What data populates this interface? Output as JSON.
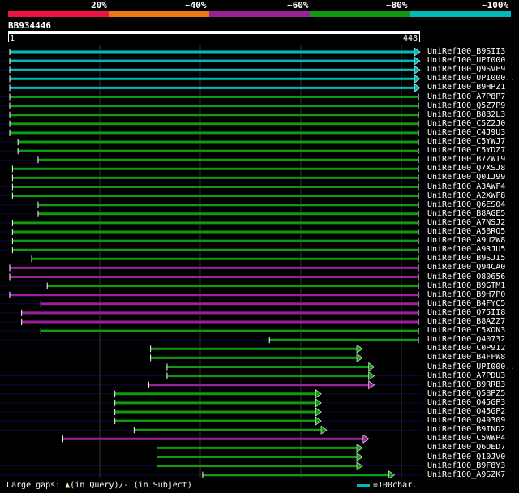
{
  "legend": {
    "labels": [
      "20%",
      "~40%",
      "~60%",
      "~80%",
      "~100%"
    ],
    "colors": [
      "#ee1144",
      "#ee7711",
      "#992299",
      "#119911",
      "#00bbbb"
    ]
  },
  "query": {
    "id": "BB934446",
    "start": "1",
    "end": "448",
    "length": 448
  },
  "footer": {
    "gaps_text": "Large gaps: ",
    "gap_query_symbol": "▲",
    "gaps_query_text": "(in Query)/",
    "gap_subject_symbol": "-",
    "gaps_subject_text": " (in Subject)",
    "scale_text": "=100char."
  },
  "hits": [
    {
      "name": "UniRef100_B9SII3",
      "color": "#00bbbb",
      "start": 1,
      "end": 448,
      "arrow": true
    },
    {
      "name": "UniRef100_UPI000..",
      "color": "#00bbbb",
      "start": 1,
      "end": 448,
      "arrow": true
    },
    {
      "name": "UniRef100_Q9SVE9",
      "color": "#00bbbb",
      "start": 1,
      "end": 448,
      "arrow": true
    },
    {
      "name": "UniRef100_UPI000..",
      "color": "#00bbbb",
      "start": 1,
      "end": 448,
      "arrow": true
    },
    {
      "name": "UniRef100_B9HPZ1",
      "color": "#00bbbb",
      "start": 1,
      "end": 448,
      "arrow": true
    },
    {
      "name": "UniRef100_A7P8P7",
      "color": "#119911",
      "start": 1,
      "end": 448,
      "arrow": false
    },
    {
      "name": "UniRef100_Q5Z7P9",
      "color": "#119911",
      "start": 1,
      "end": 448,
      "arrow": false
    },
    {
      "name": "UniRef100_B8B2L3",
      "color": "#119911",
      "start": 1,
      "end": 448,
      "arrow": false
    },
    {
      "name": "UniRef100_C5Z2J0",
      "color": "#119911",
      "start": 1,
      "end": 448,
      "arrow": false
    },
    {
      "name": "UniRef100_C4J9U3",
      "color": "#119911",
      "start": 1,
      "end": 448,
      "arrow": false
    },
    {
      "name": "UniRef100_C5YWJ7",
      "color": "#119911",
      "start": 10,
      "end": 448,
      "arrow": false
    },
    {
      "name": "UniRef100_C5YDZ7",
      "color": "#119911",
      "start": 10,
      "end": 448,
      "arrow": false
    },
    {
      "name": "UniRef100_B7ZWT9",
      "color": "#119911",
      "start": 32,
      "end": 448,
      "arrow": false
    },
    {
      "name": "UniRef100_Q7XSJ8",
      "color": "#119911",
      "start": 4,
      "end": 448,
      "arrow": false
    },
    {
      "name": "UniRef100_Q01J99",
      "color": "#119911",
      "start": 4,
      "end": 448,
      "arrow": false
    },
    {
      "name": "UniRef100_A3AWF4",
      "color": "#119911",
      "start": 4,
      "end": 448,
      "arrow": false
    },
    {
      "name": "UniRef100_A2XWF8",
      "color": "#119911",
      "start": 4,
      "end": 448,
      "arrow": false
    },
    {
      "name": "UniRef100_Q6ES04",
      "color": "#119911",
      "start": 32,
      "end": 448,
      "arrow": false
    },
    {
      "name": "UniRef100_B8AGE5",
      "color": "#119911",
      "start": 32,
      "end": 448,
      "arrow": false
    },
    {
      "name": "UniRef100_A7NSJ2",
      "color": "#119911",
      "start": 4,
      "end": 448,
      "arrow": false
    },
    {
      "name": "UniRef100_A5BRQ5",
      "color": "#119911",
      "start": 4,
      "end": 448,
      "arrow": false
    },
    {
      "name": "UniRef100_A9U2W8",
      "color": "#119911",
      "start": 4,
      "end": 448,
      "arrow": false
    },
    {
      "name": "UniRef100_A9RJU5",
      "color": "#119911",
      "start": 4,
      "end": 448,
      "arrow": false
    },
    {
      "name": "UniRef100_B9SJI5",
      "color": "#119911",
      "start": 25,
      "end": 448,
      "arrow": false
    },
    {
      "name": "UniRef100_Q94CA0",
      "color": "#992299",
      "start": 1,
      "end": 448,
      "arrow": false
    },
    {
      "name": "UniRef100_O80656",
      "color": "#992299",
      "start": 1,
      "end": 448,
      "arrow": false
    },
    {
      "name": "UniRef100_B9GTM1",
      "color": "#119911",
      "start": 42,
      "end": 448,
      "arrow": false
    },
    {
      "name": "UniRef100_B9H7P0",
      "color": "#992299",
      "start": 1,
      "end": 448,
      "arrow": false
    },
    {
      "name": "UniRef100_B4FYC5",
      "color": "#992299",
      "start": 35,
      "end": 448,
      "arrow": false
    },
    {
      "name": "UniRef100_Q75II8",
      "color": "#992299",
      "start": 14,
      "end": 448,
      "arrow": false
    },
    {
      "name": "UniRef100_B8AZZ7",
      "color": "#992299",
      "start": 14,
      "end": 448,
      "arrow": false
    },
    {
      "name": "UniRef100_C5XON3",
      "color": "#119911",
      "start": 35,
      "end": 448,
      "arrow": false
    },
    {
      "name": "UniRef100_Q40732",
      "color": "#119911",
      "start": 285,
      "end": 448,
      "arrow": false
    },
    {
      "name": "UniRef100_C0P912",
      "color": "#119911",
      "start": 155,
      "end": 385,
      "arrow": true
    },
    {
      "name": "UniRef100_B4FFW8",
      "color": "#119911",
      "start": 155,
      "end": 385,
      "arrow": true
    },
    {
      "name": "UniRef100_UPI000..",
      "color": "#119911",
      "start": 173,
      "end": 398,
      "arrow": true
    },
    {
      "name": "UniRef100_A7PDU3",
      "color": "#119911",
      "start": 173,
      "end": 398,
      "arrow": true
    },
    {
      "name": "UniRef100_B9RRB3",
      "color": "#992299",
      "start": 153,
      "end": 398,
      "arrow": true
    },
    {
      "name": "UniRef100_Q5BPZ5",
      "color": "#119911",
      "start": 116,
      "end": 340,
      "arrow": true
    },
    {
      "name": "UniRef100_Q45GP3",
      "color": "#119911",
      "start": 116,
      "end": 340,
      "arrow": true
    },
    {
      "name": "UniRef100_Q45GP2",
      "color": "#119911",
      "start": 116,
      "end": 340,
      "arrow": true
    },
    {
      "name": "UniRef100_Q49309",
      "color": "#119911",
      "start": 116,
      "end": 340,
      "arrow": true
    },
    {
      "name": "UniRef100_B9IND2",
      "color": "#119911",
      "start": 137,
      "end": 346,
      "arrow": true
    },
    {
      "name": "UniRef100_C5WWP4",
      "color": "#992299",
      "start": 59,
      "end": 392,
      "arrow": true
    },
    {
      "name": "UniRef100_Q6OED7",
      "color": "#119911",
      "start": 162,
      "end": 385,
      "arrow": true
    },
    {
      "name": "UniRef100_Q10JV0",
      "color": "#119911",
      "start": 162,
      "end": 385,
      "arrow": true
    },
    {
      "name": "UniRef100_B9F8Y3",
      "color": "#119911",
      "start": 162,
      "end": 385,
      "arrow": true
    },
    {
      "name": "UniRef100_A9SZK7",
      "color": "#119911",
      "start": 212,
      "end": 420,
      "arrow": true
    }
  ]
}
